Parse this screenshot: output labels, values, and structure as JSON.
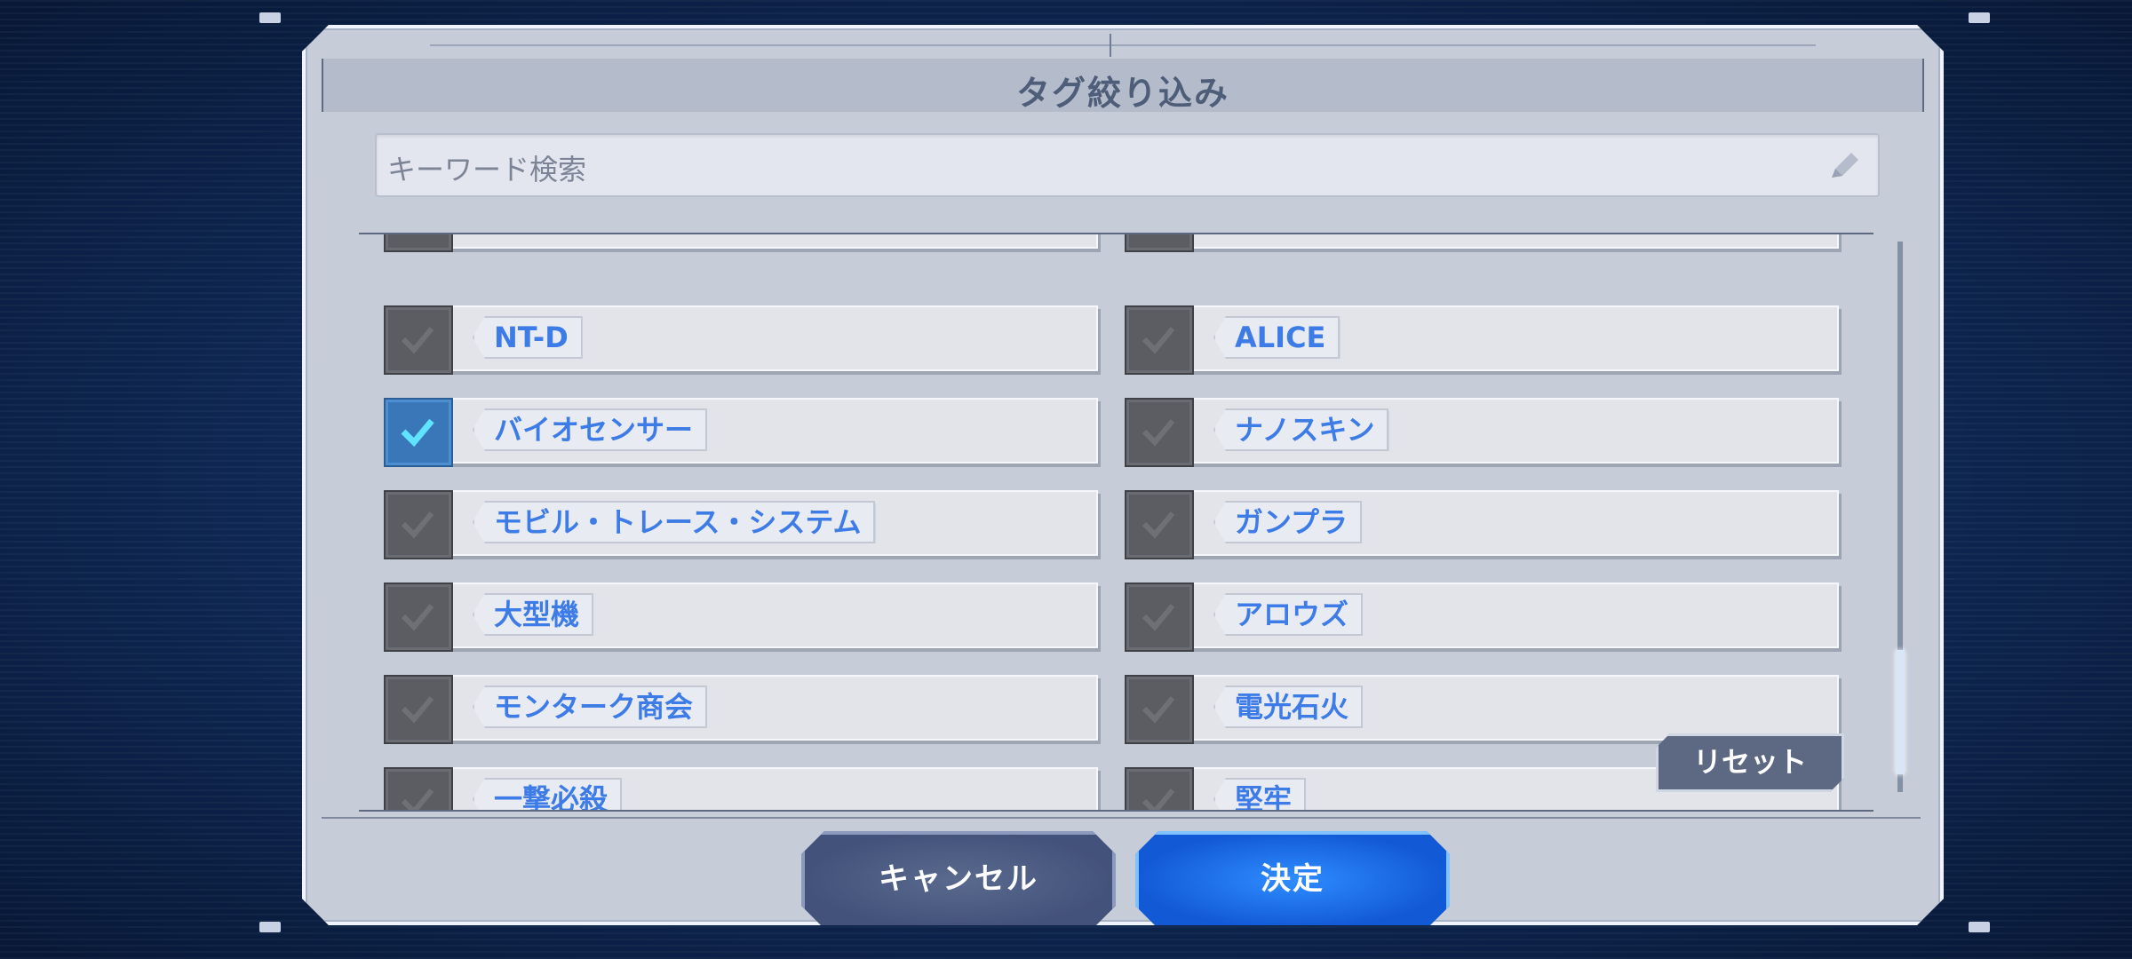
{
  "dialog": {
    "title": "タグ絞り込み",
    "search": {
      "placeholder": "キーワード検索",
      "icon": "pencil-icon"
    },
    "tags": [
      {
        "label": "NT-D",
        "checked": false
      },
      {
        "label": "ALICE",
        "checked": false
      },
      {
        "label": "バイオセンサー",
        "checked": true
      },
      {
        "label": "ナノスキン",
        "checked": false
      },
      {
        "label": "モビル・トレース・システム",
        "checked": false
      },
      {
        "label": "ガンプラ",
        "checked": false
      },
      {
        "label": "大型機",
        "checked": false
      },
      {
        "label": "アロウズ",
        "checked": false
      },
      {
        "label": "モンターク商会",
        "checked": false
      },
      {
        "label": "電光石火",
        "checked": false
      },
      {
        "label": "一撃必殺",
        "checked": false
      },
      {
        "label": "堅牢",
        "checked": false
      }
    ],
    "reset_label": "リセット",
    "cancel_label": "キャンセル",
    "confirm_label": "決定"
  },
  "colors": {
    "tag_text": "#3d7be6",
    "checked_box": "#3a77b9",
    "confirm_button": "#1f6fee",
    "cancel_button": "#4a5a82"
  }
}
